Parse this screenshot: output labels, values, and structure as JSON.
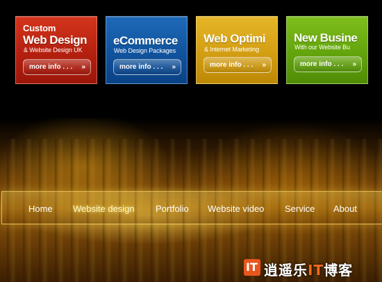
{
  "service_boxes": [
    {
      "kicker": "Custom",
      "title": "Web Design",
      "subtitle": "& Website Design UK",
      "button_label": "more info . . .",
      "button_arrows": "»",
      "color": "#c22b14"
    },
    {
      "kicker": "",
      "title": "eCommerce",
      "subtitle": "Web Design Packages",
      "button_label": "more info . . .",
      "button_arrows": "»",
      "color": "#1560ad"
    },
    {
      "kicker": "",
      "title": "Web Optimi",
      "subtitle": "& Internet Marketing",
      "button_label": "more info . . .",
      "button_arrows": "»",
      "color": "#d8a517"
    },
    {
      "kicker": "",
      "title": "New Busine",
      "subtitle": "With our Website Bu",
      "button_label": "more info . . .",
      "button_arrows": "»",
      "color": "#6cae12"
    }
  ],
  "nav": {
    "items": [
      "Home",
      "Website design",
      "Portfolio",
      "Website video",
      "Service",
      "About"
    ],
    "active": "Website design"
  },
  "watermark": {
    "logo_glyph": "IT",
    "text_before": "逍遥乐",
    "text_highlight": "IT",
    "text_after": "博客",
    "accent": "#e8561d"
  }
}
